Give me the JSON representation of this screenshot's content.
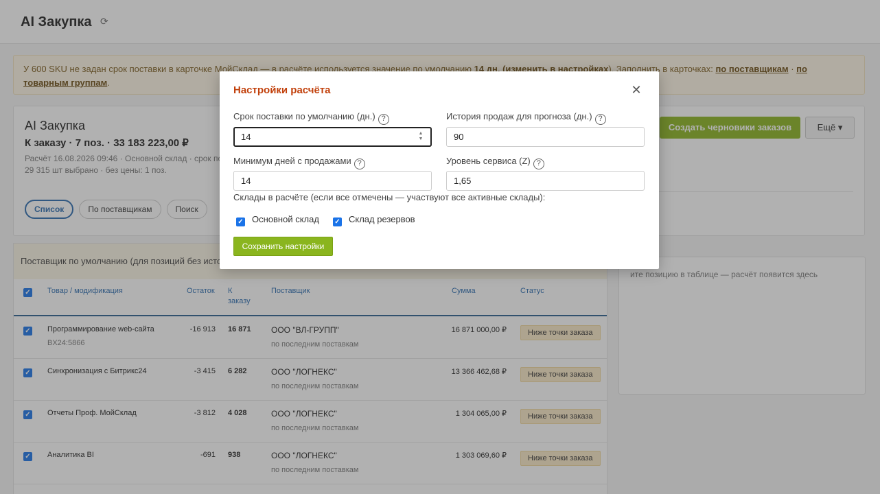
{
  "app": {
    "title": "AI Закупка"
  },
  "warning": {
    "text1": "У 600 SKU не задан срок поставки в карточке МойСклад — в расчёте используется значение по умолчанию ",
    "days": "14 дн.",
    "paren_open": " (",
    "settings_link": "изменить в настройках",
    "text2": "). Заполнить в карточках: ",
    "link_suppliers": "по поставщикам",
    "sep": " · ",
    "link_groups": "по товарным группам",
    "end": "."
  },
  "summary": {
    "title": "AI Закупка",
    "total": "К заказу · 7 поз. · 33 183 223,00 ₽",
    "meta1": "Расчёт 16.08.2026 09:46 · Основной склад · срок по",
    "meta2": "29 315 шт выбрано · без цены: 1 поз.",
    "create_button": "Создать черновики заказов",
    "more_button": "Ещё ▾",
    "pills": [
      "Список",
      "По поставщикам",
      "Поиск"
    ]
  },
  "table": {
    "supplier_bar": "Поставщик по умолчанию (для позиций без исто",
    "headers": {
      "product": "Товар / модификация",
      "rest": "Остаток",
      "order": "К заказу",
      "supplier": "Поставщик",
      "sum": "Сумма",
      "status": "Статус"
    },
    "rows": [
      {
        "name": "Программирование web-сайта",
        "code": "BX24:5866",
        "rest": "-16 913",
        "order": "16 871",
        "supplier": "ООО \"ВЛ-ГРУПП\"",
        "supplier_sub": "по последним поставкам",
        "sum": "16 871 000,00 ₽",
        "status": "Ниже точки заказа"
      },
      {
        "name": "Синхронизация с Битрикс24",
        "code": "",
        "rest": "-3 415",
        "order": "6 282",
        "supplier": "ООО \"ЛОГНЕКС\"",
        "supplier_sub": "по последним поставкам",
        "sum": "13 366 462,68 ₽",
        "status": "Ниже точки заказа"
      },
      {
        "name": "Отчеты Проф. МойСклад",
        "code": "",
        "rest": "-3 812",
        "order": "4 028",
        "supplier": "ООО \"ЛОГНЕКС\"",
        "supplier_sub": "по последним поставкам",
        "sum": "1 304 065,00 ₽",
        "status": "Ниже точки заказа"
      },
      {
        "name": "Аналитика BI",
        "code": "",
        "rest": "-691",
        "order": "938",
        "supplier": "ООО \"ЛОГНЕКС\"",
        "supplier_sub": "по последним поставкам",
        "sum": "1 303 069,60 ₽",
        "status": "Ниже точки заказа"
      }
    ]
  },
  "detail": {
    "hint": "ите позицию в таблице — расчёт появится здесь"
  },
  "modal": {
    "title": "Настройки расчёта",
    "lead_time_label": "Срок поставки по умолчанию (дн.)",
    "lead_time_value": "14",
    "history_label": "История продаж для прогноза (дн.)",
    "history_value": "90",
    "min_days_label": "Минимум дней с продажами",
    "min_days_value": "14",
    "service_label": "Уровень сервиса (Z)",
    "service_value": "1,65",
    "warehouses_label": "Склады в расчёте (если все отмечены — участвуют все активные склады):",
    "warehouses": [
      "Основной склад",
      "Склад резервов"
    ],
    "save_button": "Сохранить настройки"
  },
  "colors": {
    "accent": "#8ab51e",
    "title_orange": "#c2410c",
    "link_blue": "#2b6cb0",
    "checkbox": "#1a73e8"
  }
}
